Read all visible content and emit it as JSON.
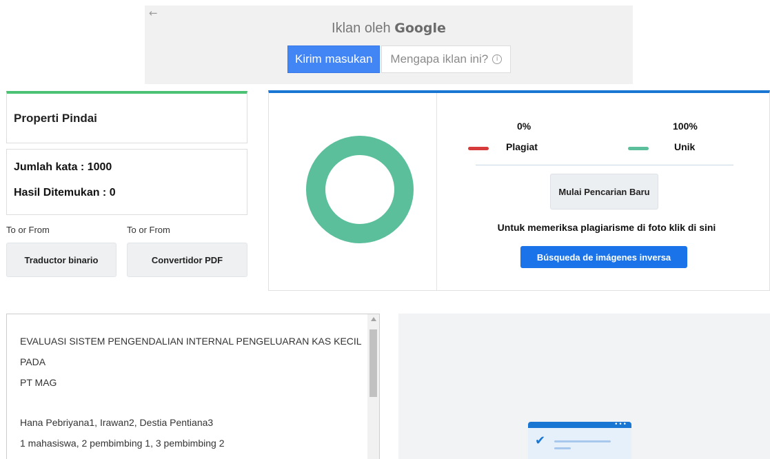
{
  "ad": {
    "back_glyph": "←",
    "title_prefix": "Iklan oleh",
    "title_brand": "Google",
    "feedback_button": "Kirim masukan",
    "why_button": "Mengapa iklan ini?",
    "info_glyph": "i"
  },
  "scan": {
    "properties_title": "Properti Pindai",
    "word_count_label": "Jumlah kata : ",
    "word_count_value": "1000",
    "results_found_label": "Hasil Ditemukan : ",
    "results_found_value": "0"
  },
  "tools": {
    "left_caption": "To or From",
    "left_button": "Traductor binario",
    "right_caption": "To or From",
    "right_button": "Convertidor PDF"
  },
  "result": {
    "plagiarism_percent": "0%",
    "plagiarism_label": "Plagiat",
    "unique_percent": "100%",
    "unique_label": "Unik",
    "new_search_button": "Mulai Pencarian Baru",
    "photo_note": "Untuk memeriksa plagiarisme di foto klik di sini",
    "reverse_image_button": "Búsqueda de imágenes inversa",
    "unique_fraction": 1.0,
    "plagiarism_fraction": 0.0
  },
  "document": {
    "line1": "EVALUASI SISTEM PENGENDALIAN INTERNAL PENGELUARAN KAS KECIL PADA",
    "line2": "PT MAG",
    "line3": "Hana Pebriyana1, Irawan2, Destia Pentiana3",
    "line4": "1 mahasiswa, 2 pembimbing 1, 3 pembimbing 2"
  },
  "colors": {
    "unique": "#5bbf9c",
    "plagiarism": "#d63a3a",
    "accent_blue": "#1976d2",
    "accent_green": "#4cc274"
  },
  "icons": {
    "back": "arrow-left-icon",
    "info": "info-circle-icon",
    "check": "checkmark-icon"
  }
}
